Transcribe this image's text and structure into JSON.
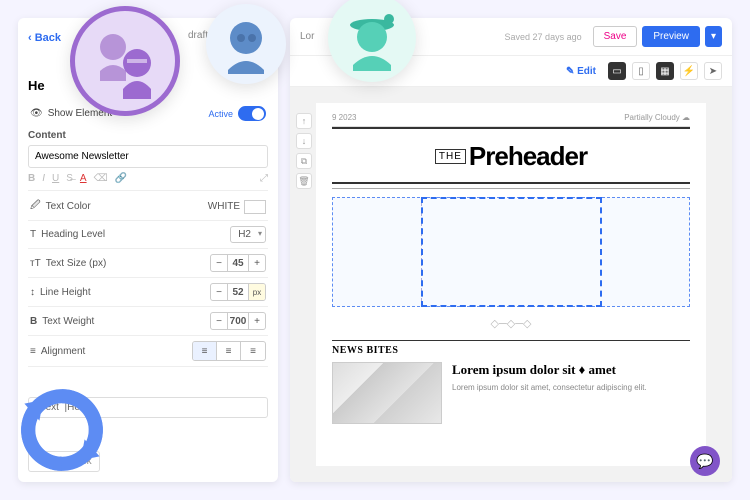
{
  "header": {
    "back": "Back",
    "draft": "draft",
    "heading": "He"
  },
  "saved": "Saved 27 days ago",
  "buttons": {
    "save": "Save",
    "preview": "Preview",
    "edit": "Edit",
    "editBlock": "Edit Block"
  },
  "showElement": {
    "label": "Show Element",
    "state": "Active"
  },
  "content": {
    "label": "Content",
    "value": "Awesome Newsletter "
  },
  "props": {
    "textColor": {
      "label": "Text Color",
      "value": "WHITE"
    },
    "headingLevel": {
      "label": "Heading Level",
      "value": "H2"
    },
    "textSize": {
      "label": "Text Size (px)",
      "value": "45"
    },
    "lineHeight": {
      "label": "Line Height",
      "value": "52",
      "unit": "px"
    },
    "textWeight": {
      "label": "Text Weight",
      "value": "700"
    },
    "alignment": {
      "label": "Alignment"
    }
  },
  "sidebarText": "Text",
  "canvas": {
    "lor": "Lor",
    "date": "9 2023",
    "weather": "Partially Cloudy",
    "the": "THE",
    "title": "Preheader",
    "section": "NEWS BITES",
    "articleTitle": "Lorem ipsum dolor sit ♦ amet",
    "articleBody": "Lorem ipsum dolor sit amet, consectetur adipiscing elit."
  }
}
